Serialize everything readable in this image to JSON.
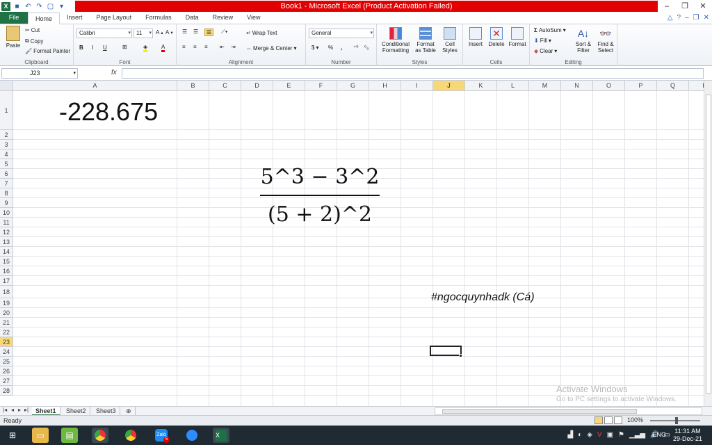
{
  "window": {
    "title": "Book1 - Microsoft Excel (Product Activation Failed)",
    "controls": [
      "–",
      "❐",
      "✕"
    ]
  },
  "ribbon_tabs": [
    "File",
    "Home",
    "Insert",
    "Page Layout",
    "Formulas",
    "Data",
    "Review",
    "View"
  ],
  "ribbon": {
    "clipboard": {
      "paste": "Paste",
      "cut": "Cut",
      "copy": "Copy",
      "format_painter": "Format Painter",
      "label": "Clipboard"
    },
    "font": {
      "name": "Calibri",
      "size": "11",
      "label": "Font",
      "bold": "B",
      "italic": "I",
      "underline": "U"
    },
    "alignment": {
      "wrap_text": "Wrap Text",
      "merge_center": "Merge & Center",
      "label": "Alignment"
    },
    "number": {
      "format": "General",
      "currency": "$",
      "percent": "%",
      "comma": ",",
      "label": "Number"
    },
    "styles": {
      "conditional": "Conditional Formatting",
      "table": "Format as Table",
      "cell_styles": "Cell Styles",
      "label": "Styles"
    },
    "cells": {
      "insert": "Insert",
      "delete": "Delete",
      "format": "Format",
      "label": "Cells"
    },
    "editing": {
      "autosum": "AutoSum",
      "fill": "Fill",
      "clear": "Clear",
      "sort_filter": "Sort & Filter",
      "find_select": "Find & Select",
      "label": "Editing"
    }
  },
  "formula_bar": {
    "name_box": "J23",
    "fx": "fx",
    "value": ""
  },
  "columns": [
    "A",
    "B",
    "C",
    "D",
    "E",
    "F",
    "G",
    "H",
    "I",
    "J",
    "K",
    "L",
    "M",
    "N",
    "O",
    "P",
    "Q",
    "R"
  ],
  "rows": [
    "1",
    "2",
    "3",
    "4",
    "5",
    "6",
    "7",
    "8",
    "9",
    "10",
    "11",
    "12",
    "13",
    "14",
    "15",
    "16",
    "17",
    "18",
    "19",
    "20",
    "21",
    "22",
    "23",
    "24",
    "25",
    "26",
    "27",
    "28"
  ],
  "cells": {
    "A1": "-228.675",
    "J18": "#ngocquynhadk (Cá)"
  },
  "equation": {
    "numerator": "5^3 − 3^2",
    "denominator": "(5 + 2)^2"
  },
  "selected_cell": "J23",
  "watermark": {
    "line1": "Activate Windows",
    "line2": "Go to PC settings to activate Windows."
  },
  "sheets": [
    "Sheet1",
    "Sheet2",
    "Sheet3"
  ],
  "active_sheet": "Sheet1",
  "status": {
    "text": "Ready",
    "zoom": "100%"
  },
  "taskbar": {
    "apps": [
      "folder",
      "books",
      "chrome",
      "chrome",
      "Zalo",
      "zoom",
      "excel"
    ],
    "zalo_badge": "5",
    "language": "ENG",
    "time": "11:31 AM",
    "date": "29-Dec-21"
  },
  "colors": {
    "title_bar": "#e30000",
    "file_tab": "#1f7244",
    "selection": "#f8d777"
  }
}
